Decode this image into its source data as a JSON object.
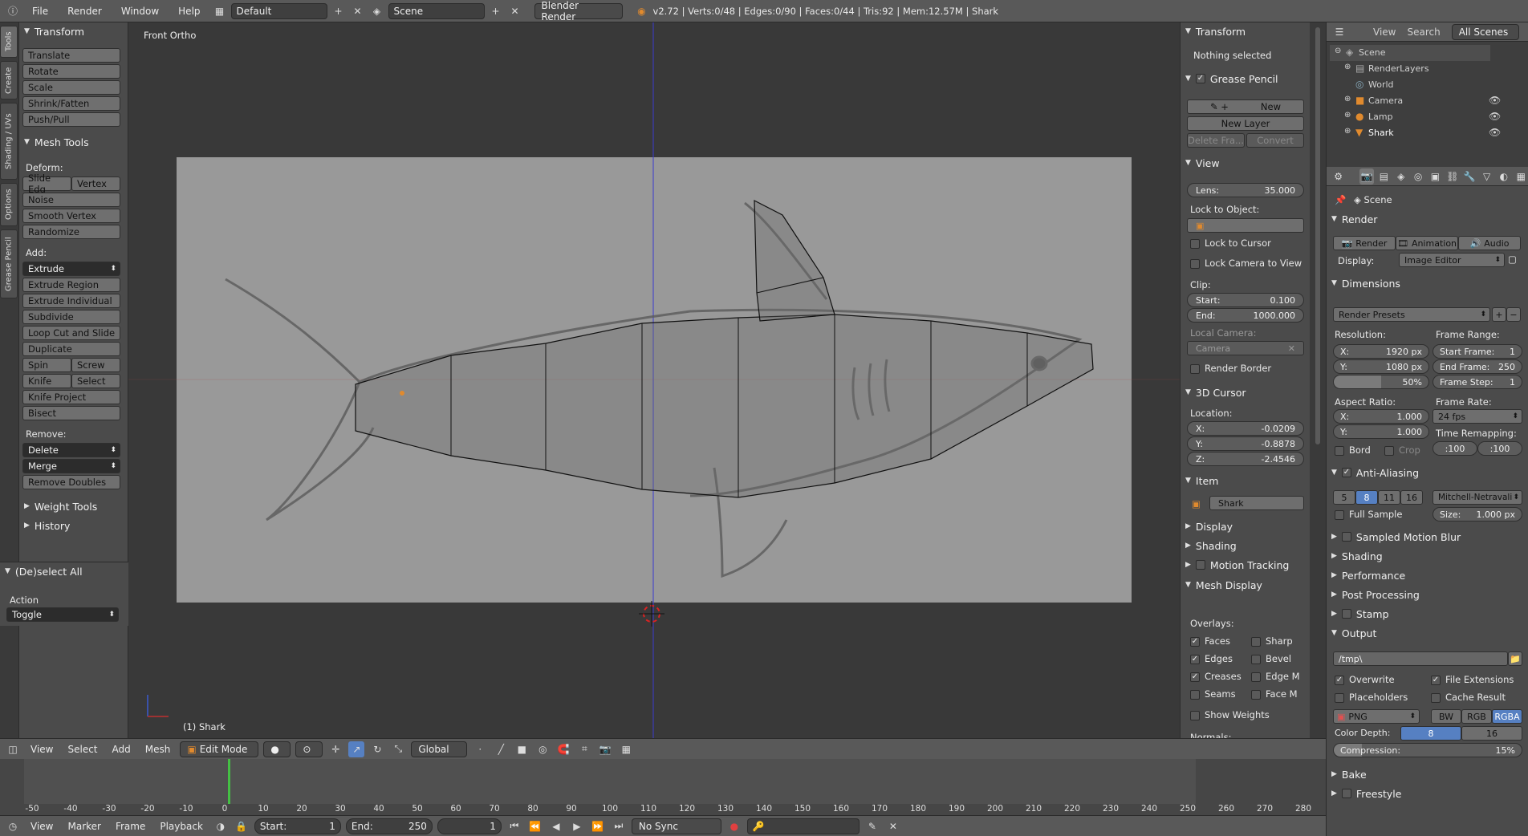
{
  "topbar": {
    "menus": [
      "File",
      "Render",
      "Window",
      "Help"
    ],
    "layout": "Default",
    "scene": "Scene",
    "engine": "Blender Render",
    "stats": "v2.72 | Verts:0/48 | Edges:0/90 | Faces:0/44 | Tris:92 | Mem:12.57M | Shark"
  },
  "tool_tabs": [
    "Tools",
    "Create",
    "Shading / UVs",
    "Options",
    "Grease Pencil"
  ],
  "toolshelf": {
    "transform": {
      "title": "Transform",
      "buttons": [
        "Translate",
        "Rotate",
        "Scale",
        "Shrink/Fatten",
        "Push/Pull"
      ]
    },
    "mesh_tools": {
      "title": "Mesh Tools",
      "deform_label": "Deform:",
      "slide_edge": "Slide Edg",
      "vertex": "Vertex",
      "noise": "Noise",
      "smooth_vertex": "Smooth Vertex",
      "randomize": "Randomize",
      "add_label": "Add:",
      "extrude": "Extrude",
      "extrude_region": "Extrude Region",
      "extrude_individual": "Extrude Individual",
      "subdivide": "Subdivide",
      "loop_cut": "Loop Cut and Slide",
      "duplicate": "Duplicate",
      "spin": "Spin",
      "screw": "Screw",
      "knife": "Knife",
      "select": "Select",
      "knife_project": "Knife Project",
      "bisect": "Bisect",
      "remove_label": "Remove:",
      "delete": "Delete",
      "merge": "Merge",
      "remove_doubles": "Remove Doubles"
    },
    "weight_tools": "Weight Tools",
    "history": "History",
    "operator": {
      "title": "(De)select All",
      "action_label": "Action",
      "action_value": "Toggle"
    }
  },
  "viewport": {
    "view_label": "Front Ortho",
    "object_label": "(1) Shark"
  },
  "npanel": {
    "transform": "Transform",
    "nothing_selected": "Nothing selected",
    "grease_pencil": "Grease Pencil",
    "gp_new": "New",
    "gp_new_layer": "New Layer",
    "gp_delete_frame": "Delete Fra...",
    "gp_convert": "Convert",
    "view": "View",
    "lens_label": "Lens:",
    "lens_value": "35.000",
    "lock_to_object": "Lock to Object:",
    "lock_to_cursor": "Lock to Cursor",
    "lock_camera": "Lock Camera to View",
    "clip_label": "Clip:",
    "clip_start_label": "Start:",
    "clip_start": "0.100",
    "clip_end_label": "End:",
    "clip_end": "1000.000",
    "local_camera": "Local Camera:",
    "camera": "Camera",
    "render_border": "Render Border",
    "cursor_3d": "3D Cursor",
    "location": "Location:",
    "cx_label": "X:",
    "cx": "-0.0209",
    "cy_label": "Y:",
    "cy": "-0.8878",
    "cz_label": "Z:",
    "cz": "-2.4546",
    "item": "Item",
    "item_name": "Shark",
    "display": "Display",
    "shading": "Shading",
    "motion_tracking": "Motion Tracking",
    "mesh_display": "Mesh Display",
    "overlays": "Overlays:",
    "faces": "Faces",
    "sharp": "Sharp",
    "edges": "Edges",
    "bevel": "Bevel",
    "creases": "Creases",
    "edge_m": "Edge M",
    "seams": "Seams",
    "face_m": "Face M",
    "show_weights": "Show Weights",
    "normals": "Normals:"
  },
  "outliner": {
    "view": "View",
    "search": "Search",
    "all_scenes": "All Scenes",
    "items": [
      "Scene",
      "RenderLayers",
      "World",
      "Camera",
      "Lamp",
      "Shark"
    ]
  },
  "properties": {
    "scene": "Scene",
    "render": "Render",
    "tab_render": "Render",
    "tab_animation": "Animation",
    "tab_audio": "Audio",
    "display_label": "Display:",
    "display_value": "Image Editor",
    "dimensions": "Dimensions",
    "render_presets": "Render Presets",
    "resolution": "Resolution:",
    "frame_range": "Frame Range:",
    "res_x_label": "X:",
    "res_x": "1920 px",
    "res_y_label": "Y:",
    "res_y": "1080 px",
    "res_pct": "50%",
    "start_frame_label": "Start Frame:",
    "start_frame": "1",
    "end_frame_label": "End Frame:",
    "end_frame": "250",
    "frame_step_label": "Frame Step:",
    "frame_step": "1",
    "aspect_ratio": "Aspect Ratio:",
    "frame_rate": "Frame Rate:",
    "asp_x_label": "X:",
    "asp_x": "1.000",
    "asp_y_label": "Y:",
    "asp_y": "1.000",
    "fps": "24 fps",
    "time_remapping": "Time Remapping:",
    "remap_old": ":100",
    "remap_new": ":100",
    "bord": "Bord",
    "crop": "Crop",
    "anti_aliasing": "Anti-Aliasing",
    "aa_5": "5",
    "aa_8": "8",
    "aa_11": "11",
    "aa_16": "16",
    "aa_filter": "Mitchell-Netravali",
    "full_sample": "Full Sample",
    "aa_size_label": "Size:",
    "aa_size": "1.000 px",
    "sampled_motion_blur": "Sampled Motion Blur",
    "shading": "Shading",
    "performance": "Performance",
    "post_processing": "Post Processing",
    "stamp": "Stamp",
    "output": "Output",
    "output_path": "/tmp\\",
    "overwrite": "Overwrite",
    "file_extensions": "File Extensions",
    "placeholders": "Placeholders",
    "cache_result": "Cache Result",
    "format": "PNG",
    "bw": "BW",
    "rgb": "RGB",
    "rgba": "RGBA",
    "color_depth_label": "Color Depth:",
    "depth_8": "8",
    "depth_16": "16",
    "compression_label": "Compression:",
    "compression": "15%",
    "bake": "Bake",
    "freestyle": "Freestyle"
  },
  "viewport_header": {
    "menus": [
      "View",
      "Select",
      "Add",
      "Mesh"
    ],
    "mode": "Edit Mode",
    "orientation": "Global"
  },
  "timeline": {
    "ticks": [
      "-50",
      "-40",
      "-30",
      "-20",
      "-10",
      "0",
      "10",
      "20",
      "30",
      "40",
      "50",
      "60",
      "70",
      "80",
      "90",
      "100",
      "110",
      "120",
      "130",
      "140",
      "150",
      "160",
      "170",
      "180",
      "190",
      "200",
      "210",
      "220",
      "230",
      "240",
      "250",
      "260",
      "270",
      "280"
    ],
    "menus": [
      "View",
      "Marker",
      "Frame",
      "Playback"
    ],
    "start_label": "Start:",
    "start": "1",
    "end_label": "End:",
    "end": "250",
    "current": "1",
    "sync": "No Sync"
  },
  "colors": {
    "accent": "#5680c2",
    "header": "#595959",
    "panel": "#4b4b4b",
    "frame_marker": "#44c044"
  }
}
